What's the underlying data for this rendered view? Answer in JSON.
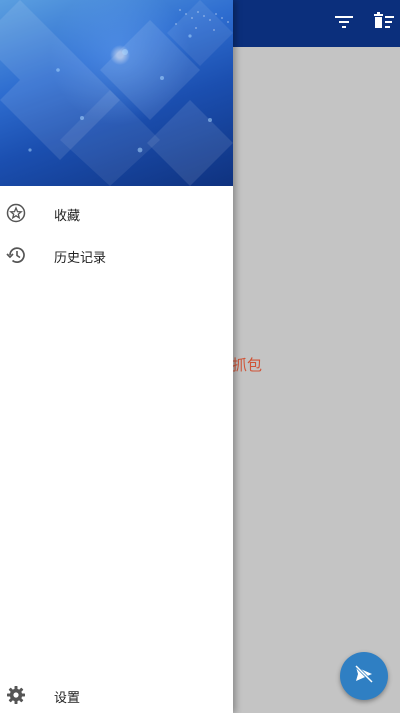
{
  "app_bar": {
    "background_color": "#0b2f7c",
    "actions": [
      {
        "name": "filter",
        "icon": "filter-icon"
      },
      {
        "name": "clear",
        "icon": "delete-sweep-icon"
      }
    ]
  },
  "main": {
    "hint_text": "点击开始抓包",
    "hint_color": "#d05437",
    "fab_icon": "send-off-icon",
    "fab_color": "#2f7fc3"
  },
  "drawer": {
    "header_image": "blue-tech-abstract-banner",
    "items": [
      {
        "label": "收藏",
        "icon": "star-outline-icon"
      },
      {
        "label": "历史记录",
        "icon": "history-icon"
      }
    ],
    "bottom_items": [
      {
        "label": "设置",
        "icon": "gear-icon"
      }
    ]
  }
}
